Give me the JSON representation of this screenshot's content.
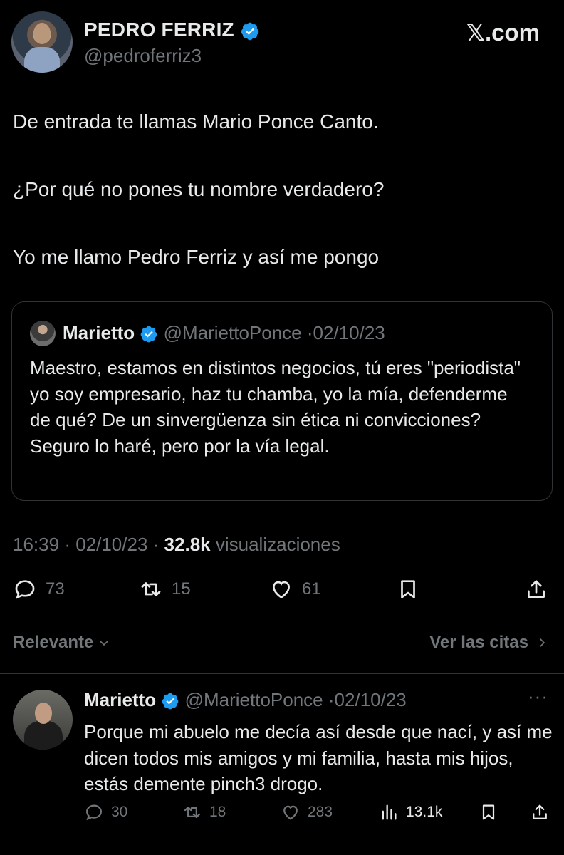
{
  "author": {
    "name": "PEDRO FERRIZ",
    "handle": "@pedroferriz3"
  },
  "brand": "𝕏.com",
  "tweet": {
    "lines": [
      "De entrada te llamas Mario Ponce Canto.",
      "¿Por qué no pones tu nombre verdadero?",
      "Yo me llamo Pedro Ferriz y así me pongo"
    ],
    "time": "16:39",
    "date": "02/10/23",
    "views_count": "32.8k",
    "views_label": "visualizaciones"
  },
  "quote": {
    "name": "Marietto",
    "handle": "@MariettoPonce",
    "date": "02/10/23",
    "text": "Maestro, estamos en distintos negocios, tú eres \"periodista\" yo soy empresario, haz tu chamba, yo la mía, defenderme de qué? De un sinvergüenza sin ética ni convicciones? Seguro lo haré, pero por la vía legal."
  },
  "actions": {
    "replies": "73",
    "reposts": "15",
    "likes": "61"
  },
  "sort": {
    "label": "Relevante",
    "quotes_label": "Ver las citas"
  },
  "reply": {
    "name": "Marietto",
    "handle": "@MariettoPonce",
    "date": "02/10/23",
    "more": "···",
    "text": "Porque mi abuelo me decía así desde que nací, y así me dicen todos mis amigos y mi familia, hasta mis hijos, estás demente pinch3 drogo.",
    "replies": "30",
    "reposts": "18",
    "likes": "283",
    "views": "13.1k"
  },
  "colors": {
    "background": "#000000",
    "text": "#e7e9ea",
    "muted": "#71767b",
    "verified": "#1d9bf0",
    "border": "#2f3336"
  }
}
